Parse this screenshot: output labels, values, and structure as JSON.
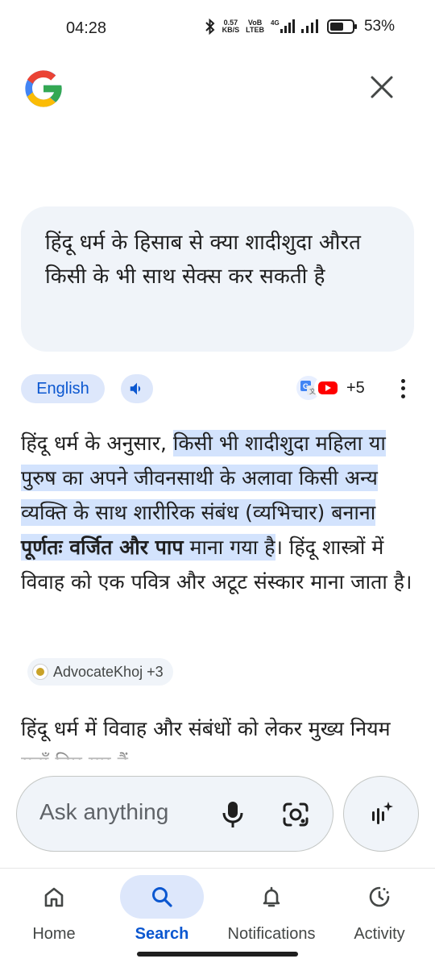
{
  "status_bar": {
    "time": "04:28",
    "speed_value": "0.57",
    "speed_unit": "KB/S",
    "volte_top": "VoB",
    "volte_bottom": "LTEB",
    "battery_percent": "53%"
  },
  "header": {
    "logo": "google-g-icon",
    "close_icon": "close-icon"
  },
  "query": {
    "text": "हिंदू धर्म के हिसाब से क्या शादीशुदा औरत किसी के भी साथ सेक्स कर सकती है"
  },
  "answer_toolbar": {
    "language_label": "English",
    "speaker_icon": "speaker-icon",
    "sources_count": "+5"
  },
  "answer": {
    "intro": "हिंदू धर्म के अनुसार, ",
    "highlight_part1": "किसी भी शादीशुदा महिला या पुरुष का अपने जीवनसाथी के अलावा किसी अन्य व्यक्ति के साथ शारीरिक संबंध (व्यभिचार) बनाना ",
    "highlight_bold": "पूर्णतः वर्जित और पाप",
    "highlight_part2": " माना गया है",
    "outro": "। हिंदू शास्त्रों में विवाह को एक पवित्र और अटूट संस्कार माना जाता है।",
    "citation": "AdvocateKhoj +3",
    "next_paragraph": "हिंदू धर्म में विवाह और संबंधों को लेकर मुख्य नियम यहाँ दिए गए हैं:"
  },
  "ask_bar": {
    "placeholder": "Ask anything"
  },
  "bottom_nav": {
    "items": [
      {
        "label": "Home",
        "icon": "home-icon",
        "active": false
      },
      {
        "label": "Search",
        "icon": "search-icon",
        "active": true
      },
      {
        "label": "Notifications",
        "icon": "bell-icon",
        "active": false
      },
      {
        "label": "Activity",
        "icon": "activity-icon",
        "active": false
      }
    ]
  },
  "colors": {
    "accent": "#0b57d0",
    "chip_bg": "#dde7fb",
    "highlight": "#d3e3fd",
    "surface": "#f0f4f9"
  }
}
